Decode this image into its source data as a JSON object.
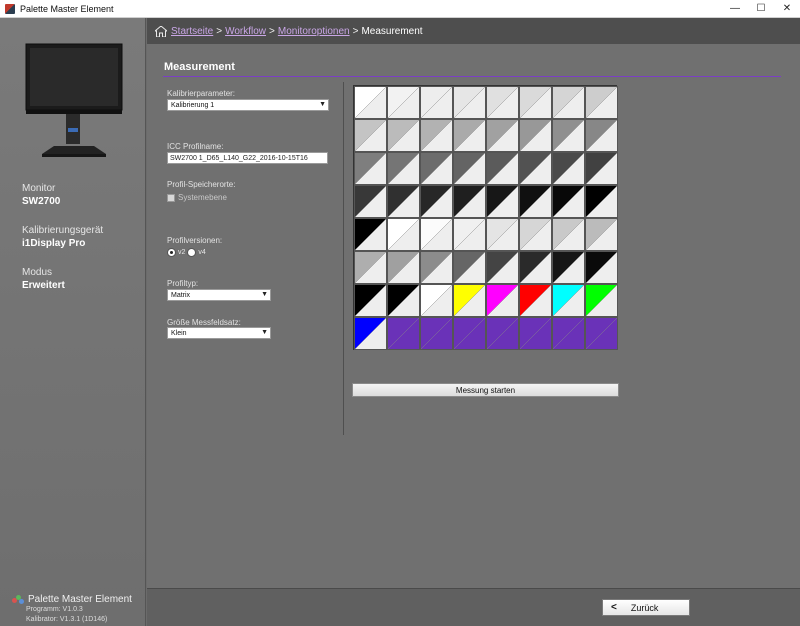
{
  "window": {
    "title": "Palette Master Element",
    "minimize_glyph": "—",
    "maximize_glyph": "☐",
    "close_glyph": "✕"
  },
  "sidebar": {
    "monitor_label": "Monitor",
    "monitor_value": "SW2700",
    "device_label": "Kalibrierungsgerät",
    "device_value": "i1Display Pro",
    "mode_label": "Modus",
    "mode_value": "Erweitert",
    "brand": "Palette Master Element",
    "program_version": "Programm: V1.0.3",
    "calibrator_version": "Kalibrator: V1.3.1 (1D146)"
  },
  "breadcrumb": {
    "items": [
      "Startseite",
      "Workflow",
      "Monitoroptionen"
    ],
    "separator": ">",
    "current": "Measurement"
  },
  "main": {
    "section_title": "Measurement",
    "calib_param_label": "Kalibrierparameter:",
    "calib_param_value": "Kalibrierung 1",
    "icc_label": "ICC Profilname:",
    "icc_value": "SW2700 1_D65_L140_G22_2016-10-15T16",
    "storage_label": "Profil-Speicherorte:",
    "storage_option": "Systemebene",
    "version_label": "Profilversionen:",
    "version_v2": "v2",
    "version_v4": "v4",
    "profiletype_label": "Profiltyp:",
    "profiletype_value": "Matrix",
    "patchsize_label": "Größe Messfeldsatz:",
    "patchsize_value": "Klein",
    "start_button": "Messung starten"
  },
  "patches": [
    [
      "#ffffff",
      "#f2f2f2",
      "#ededed",
      "#e6e6e6",
      "#e0e0e0",
      "#dadada",
      "#d5d5d5",
      "#cdcdcd"
    ],
    [
      "#c4c4c4",
      "#bbbbbb",
      "#b2b2b2",
      "#aaaaaa",
      "#a1a1a1",
      "#989898",
      "#8f8f8f",
      "#878787"
    ],
    [
      "#7e7e7e",
      "#757575",
      "#6c6c6c",
      "#646464",
      "#5b5b5b",
      "#525252",
      "#4a4a4a",
      "#414141"
    ],
    [
      "#383838",
      "#303030",
      "#272727",
      "#1f1f1f",
      "#171717",
      "#101010",
      "#080808",
      "#000000"
    ],
    [
      "#000000",
      "#ffffff",
      "#fbfbfb",
      "#f0f0f0",
      "#e4e4e4",
      "#d6d6d6",
      "#c9c9c9",
      "#bbbbbb"
    ],
    [
      "#aeaeae",
      "#a0a0a0",
      "#8c8c8c",
      "#666666",
      "#444444",
      "#2a2a2a",
      "#161616",
      "#0a0a0a"
    ],
    [
      "#000000",
      "#000000",
      "#ffffff",
      "#ffff00",
      "#ff00ff",
      "#ff0000",
      "#00ffff",
      "#00ff00"
    ],
    [
      "#0000ff",
      "#6a32b8",
      "#6a32b8",
      "#6a32b8",
      "#6a32b8",
      "#6a32b8",
      "#6a32b8",
      "#6a32b8"
    ]
  ],
  "footer": {
    "back_button": "Zurück"
  }
}
